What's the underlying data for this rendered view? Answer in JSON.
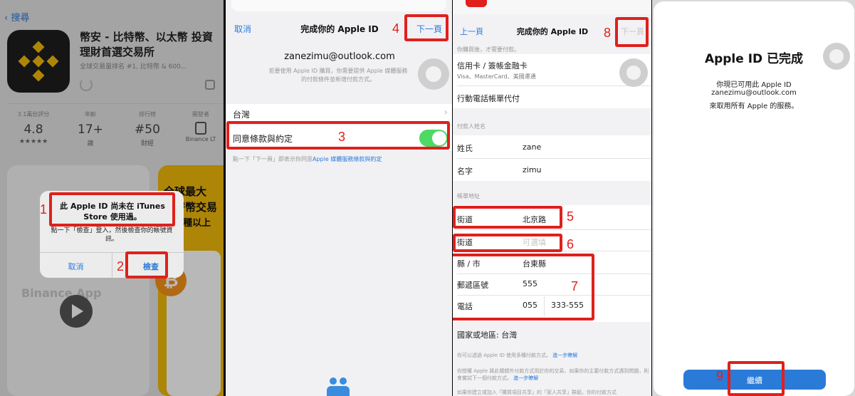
{
  "panel1": {
    "back_label": "搜尋",
    "app_title": "幣安 - 比特幣、以太幣 投資理財首選交易所",
    "app_subtitle": "全球交易量排名 #1, 比特幣 & 600...",
    "stats": [
      {
        "top": "3.1萬份評分",
        "value": "4.8",
        "bottom": "★★★★★"
      },
      {
        "top": "年齡",
        "value": "17+",
        "bottom": "歲"
      },
      {
        "top": "排行榜",
        "value": "#50",
        "bottom": "財經"
      },
      {
        "top": "開發者",
        "value": "",
        "bottom": "Binance LT"
      }
    ],
    "promo_text": [
      "全球最大",
      "加密幣交易",
      "350種以上"
    ],
    "watermark": "Binance App",
    "alert": {
      "title": "此 Apple ID 尚未在 iTunes Store 使用過。",
      "message": "點一下「檢查」登入，然後檢查你的帳號資訊。",
      "cancel": "取消",
      "review": "檢查"
    }
  },
  "panel2": {
    "cancel": "取消",
    "title": "完成你的 Apple ID",
    "next": "下一頁",
    "email": "zanezimu@outlook.com",
    "email_note": "若要使用 Apple ID 購買，你需要提供 Apple 媒體服務的付款條件並新增付款方式。",
    "country": "台灣",
    "agree_label": "同意條款與約定",
    "agree_note": "點一下「下一頁」即表示你同意",
    "agree_link": "Apple 媒體服務條款與約定"
  },
  "panel3": {
    "back": "上一頁",
    "title": "完成你的 Apple ID",
    "next": "下一頁",
    "top_note": "你購買後，才需要付款。",
    "card_option": "信用卡 / 簽帳金融卡",
    "card_brands": "Visa、MasterCard、美國運通",
    "phone_bill": "行動電話帳單代付",
    "payer_header": "付款人姓名",
    "last_name_label": "姓氏",
    "last_name_value": "zane",
    "first_name_label": "名字",
    "first_name_value": "zimu",
    "address_header": "帳單地址",
    "street1_label": "街道",
    "street1_value": "北京路",
    "street2_label": "街道",
    "street2_placeholder": "可選填",
    "city_label": "縣 / 市",
    "city_value": "台東縣",
    "zip_label": "郵遞區號",
    "zip_value": "555",
    "phone_label": "電話",
    "phone_area": "055",
    "phone_number": "333-555",
    "region": "國家或地區: 台灣",
    "note1": "你可以透過 Apple ID 使用多種付款方式。",
    "note1_link": "進一步瞭解",
    "note2": "你授權 Apple 將此類額外付款方式用於你的交易，如果你的主要付款方式遇到問題，則會嘗試下一個付款方式。",
    "note2_link": "進一步瞭解",
    "note3": "如果你建立或加入「購買項目共享」的「家人共享」群組，你的付款方式"
  },
  "panel4": {
    "title": "Apple ID 已完成",
    "line1": "你現已可用此 Apple ID",
    "email": "zanezimu@outlook.com",
    "line3": "來取用所有 Apple 的服務。",
    "continue": "繼續"
  },
  "steps": [
    "1",
    "2",
    "3",
    "4",
    "5",
    "6",
    "7",
    "8",
    "9"
  ],
  "colors": {
    "accent": "#2a7ad8",
    "annotation": "#e0201c",
    "toggle": "#4cd964"
  }
}
